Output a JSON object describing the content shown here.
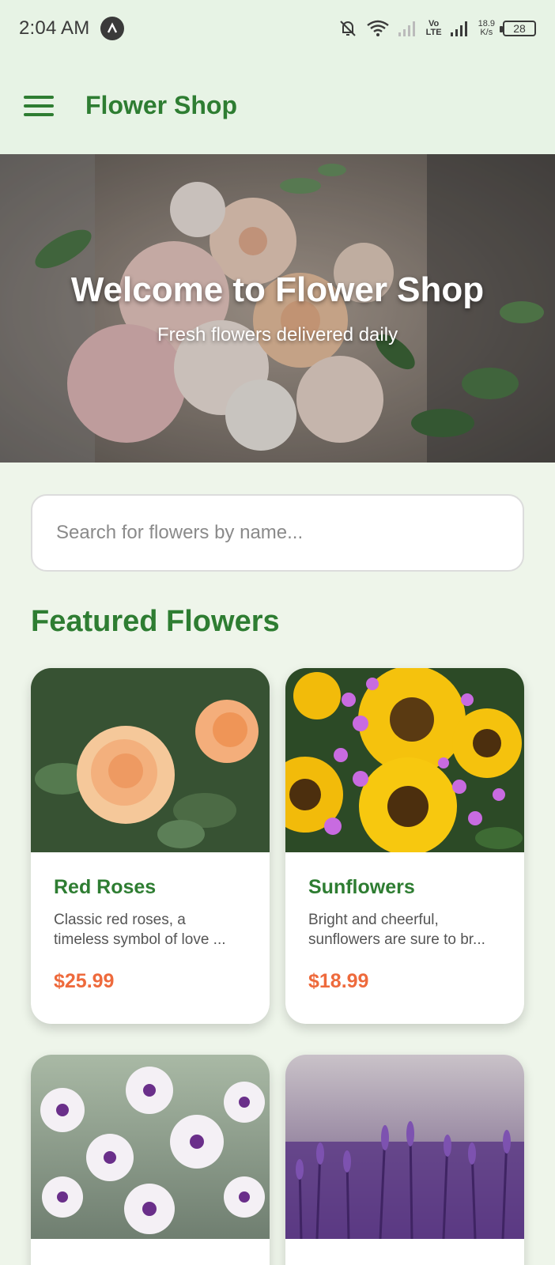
{
  "status_bar": {
    "time": "2:04 AM",
    "net_speed_value": "18.9",
    "net_speed_unit": "K/s",
    "vo": "Vo",
    "lte": "LTE",
    "battery": "28"
  },
  "app_bar": {
    "title": "Flower Shop"
  },
  "hero": {
    "title": "Welcome to Flower Shop",
    "subtitle": "Fresh flowers delivered daily"
  },
  "search": {
    "placeholder": "Search for flowers by name...",
    "value": ""
  },
  "featured": {
    "title": "Featured Flowers",
    "items": [
      {
        "name": "Red Roses",
        "description": "Classic red roses, a\ntimeless symbol of love ...",
        "price": "$25.99"
      },
      {
        "name": "Sunflowers",
        "description": "Bright and cheerful,\nsunflowers are sure to br...",
        "price": "$18.99"
      },
      {
        "name": "",
        "description": "",
        "price": ""
      },
      {
        "name": "",
        "description": "",
        "price": ""
      }
    ]
  },
  "colors": {
    "primary": "#2e7d32",
    "price": "#ee6a3c",
    "background": "#eef5ea",
    "app_bar": "#e7f3e5"
  }
}
